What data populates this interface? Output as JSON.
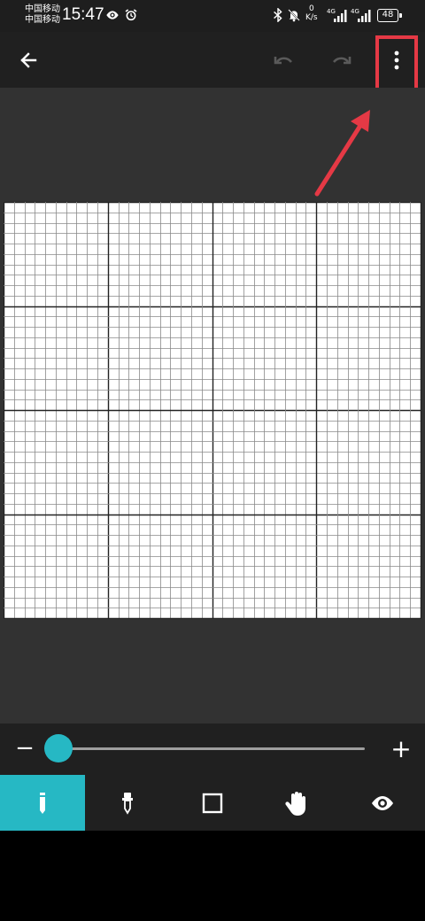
{
  "status_bar": {
    "carrier1": "中国移动",
    "carrier2": "中国移动",
    "time": "15:47",
    "net_speed_value": "0",
    "net_speed_unit": "K/s",
    "signal1_label": "4G",
    "signal2_label": "4G",
    "battery": "48"
  },
  "toolbar": {
    "back_icon": "arrow-left-icon",
    "undo_icon": "undo-icon",
    "redo_icon": "redo-icon",
    "more_icon": "more-vert-icon"
  },
  "annotation": {
    "highlight_color": "#e53945"
  },
  "zoom": {
    "minus_label": "−",
    "plus_label": "+",
    "level": 0.0,
    "thumb_color": "#26b8c4"
  },
  "tools": [
    {
      "name": "pencil",
      "icon": "pencil-icon",
      "active": true
    },
    {
      "name": "eyedropper",
      "icon": "eyedropper-icon",
      "active": false
    },
    {
      "name": "rectangle",
      "icon": "square-icon",
      "active": false
    },
    {
      "name": "hand",
      "icon": "hand-icon",
      "active": false
    },
    {
      "name": "preview",
      "icon": "eye-icon",
      "active": false
    }
  ],
  "colors": {
    "accent": "#26b8c4",
    "toolbar_bg": "#202020",
    "canvas_bg": "#323232"
  }
}
